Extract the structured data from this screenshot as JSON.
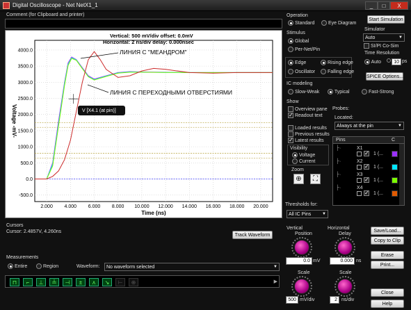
{
  "window": {
    "title": "Digital Oscilloscope - Net NetX1_1",
    "min": "_",
    "max": "□",
    "close": "X"
  },
  "comment": {
    "label": "Comment (for Clipboard and printer)",
    "value": ""
  },
  "plot": {
    "header_line1": "Vertical: 500 mV/div  offset: 0.0mV",
    "header_line2": "Horizontal: 2 ns/div  delay: 0.000nsec",
    "ylabel": "Voltage  -mV-",
    "xlabel": "Time  (ns)",
    "yticks": [
      "4000.0",
      "3500.0",
      "3000.0",
      "2500.0",
      "2000.0",
      "1500.0",
      "1000.0",
      "500.0",
      "0.0",
      "-500.0"
    ],
    "xticks": [
      "2.000",
      "4.000",
      "6.000",
      "8.000",
      "10.000",
      "12.000",
      "14.000",
      "16.000",
      "18.000",
      "20.000"
    ],
    "annot_meander": "ЛИНИЯ С \"МЕАНДРОМ\"",
    "annot_vias": "ЛИНИЯ С ПЕРЕХОДНЫМИ ОТВЕРСТИЯМИ",
    "cursor_label": "V [X4.1 (at pin)]"
  },
  "chart_data": {
    "type": "line",
    "xlabel": "Time  (ns)",
    "ylabel": "Voltage  -mV-",
    "xlim": [
      1,
      21
    ],
    "ylim": [
      -700,
      4300
    ],
    "series": [
      {
        "name": "X1",
        "color": "#9b30ff",
        "x": [
          1,
          2.0,
          2.5,
          3.0,
          3.5,
          3.8,
          4.1,
          4.5,
          5.0,
          5.5,
          6.0,
          7.0,
          8.0,
          9.0,
          10.0,
          12.0,
          14.0,
          16.0,
          18.0,
          20.0,
          21
        ],
        "y": [
          0,
          0,
          500,
          1800,
          3000,
          3600,
          3780,
          3700,
          3450,
          3200,
          3100,
          3200,
          3300,
          3330,
          3320,
          3310,
          3300,
          3300,
          3300,
          3300,
          3300
        ]
      },
      {
        "name": "X2",
        "color": "#00e5ff",
        "x": [
          1,
          2.0,
          2.5,
          3.0,
          3.5,
          3.8,
          4.1,
          4.5,
          5.0,
          5.5,
          6.0,
          7.0,
          8.0,
          9.0,
          10.0,
          12.0,
          14.0,
          16.0,
          18.0,
          20.0,
          21
        ],
        "y": [
          0,
          0,
          450,
          1700,
          2950,
          3550,
          3760,
          3690,
          3430,
          3180,
          3080,
          3190,
          3290,
          3320,
          3315,
          3305,
          3300,
          3300,
          3300,
          3300,
          3300
        ]
      },
      {
        "name": "X3",
        "color": "#7cfc00",
        "x": [
          1,
          2.0,
          2.5,
          3.0,
          3.5,
          3.8,
          4.1,
          4.5,
          5.0,
          5.5,
          6.0,
          7.0,
          8.0,
          9.0,
          10.0,
          12.0,
          14.0,
          16.0,
          18.0,
          20.0,
          21
        ],
        "y": [
          0,
          0,
          400,
          1650,
          2900,
          3520,
          3740,
          3680,
          3420,
          3170,
          3070,
          3180,
          3280,
          3310,
          3310,
          3305,
          3300,
          3300,
          3300,
          3300,
          3300
        ]
      },
      {
        "name": "X4",
        "color": "#cc2a2a",
        "x": [
          1,
          2.0,
          2.5,
          3.0,
          3.5,
          4.0,
          4.5,
          5.0,
          5.5,
          6.0,
          6.5,
          7.0,
          8.0,
          9.0,
          10.0,
          11.0,
          12.0,
          14.0,
          16.0,
          18.0,
          20.0,
          21
        ],
        "y": [
          0,
          0,
          80,
          250,
          600,
          1200,
          2100,
          3000,
          3700,
          3950,
          3700,
          3400,
          3150,
          3200,
          3350,
          3430,
          3400,
          3300,
          3280,
          3300,
          3300,
          3300
        ]
      }
    ],
    "grid": true
  },
  "cursors": {
    "title": "Cursors",
    "value": "Cursor: 2.4857V, 4.260ns",
    "track_btn": "Track Waveform"
  },
  "measurements": {
    "title": "Measurements",
    "entire": "Entire",
    "region": "Region",
    "waveform_label": "Waveform:",
    "waveform_value": "No waveform selected"
  },
  "operation": {
    "title": "Operation",
    "standard": "Standard",
    "eye": "Eye Diagram"
  },
  "stimulus": {
    "title": "Stimulus",
    "global": "Global",
    "per_net": "Per-Net/Pin",
    "edge": "Edge",
    "oscillator": "Oscillator",
    "rising": "Rising edge",
    "falling": "Falling edge"
  },
  "ic_modeling": {
    "title": "IC modeling",
    "slow": "Slow-Weak",
    "typical": "Typical",
    "fast": "Fast-Strong"
  },
  "show": {
    "title": "Show",
    "overview": "Overview pane",
    "readout": "Readout text",
    "loaded": "Loaded results",
    "previous": "Previous results",
    "latest": "Latest results"
  },
  "visibility": {
    "title": "Visibility",
    "voltage": "Voltage",
    "current": "Current"
  },
  "zoom": {
    "title": "Zoom"
  },
  "probes": {
    "title": "Probes:",
    "located": "Located:",
    "located_value": "Always at the pin",
    "pins_header": "Pins",
    "c_header": "C",
    "pins": [
      {
        "name": "X1",
        "value": "1 (...",
        "color": "#9b30ff"
      },
      {
        "name": "X2",
        "value": "1 (...",
        "color": "#00e5ff"
      },
      {
        "name": "X3",
        "value": "1 (...",
        "color": "#7cfc00"
      },
      {
        "name": "X4",
        "value": "1 (...",
        "color": "#e05a00"
      }
    ]
  },
  "thresholds": {
    "label": "Thresholds for:",
    "value": "All IC Pins"
  },
  "simulator": {
    "start_btn": "Start Simulation",
    "title": "Simulator",
    "value": "Auto",
    "si_pi": "SI/PI Co-Sim",
    "time_res": "Time Resolution",
    "auto": "Auto",
    "res_value": "10",
    "res_unit": "ps",
    "spice": "SPICE Options..."
  },
  "vertical": {
    "title": "Vertical",
    "position": "Position",
    "pos_value": "0.0",
    "pos_unit": "mV",
    "scale": "Scale",
    "scale_value": "500",
    "scale_unit": "mV/div"
  },
  "horizontal": {
    "title": "Horizontal",
    "delay": "Delay",
    "delay_value": "0.000",
    "delay_unit": "ns",
    "scale": "Scale",
    "scale_value": "2",
    "scale_unit": "ns/div"
  },
  "actions": {
    "save": "Save/Load...",
    "copy": "Copy to Clip",
    "erase": "Erase",
    "print": "Print...",
    "close": "Close",
    "help": "Help"
  }
}
